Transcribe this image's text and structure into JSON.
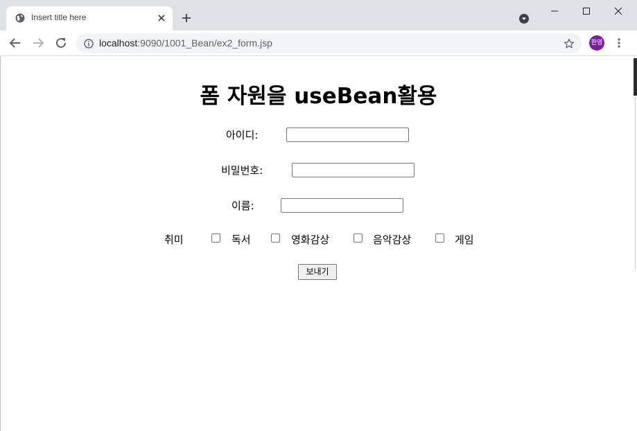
{
  "browser": {
    "tab_title": "Insert title here",
    "url_host": "localhost",
    "url_rest": ":9090/1001_Bean/ex2_form.jsp",
    "profile_label": "한영",
    "profile_color": "#7b1fa2"
  },
  "page": {
    "title": "폼 자원을 useBean활용",
    "fields": {
      "id_label": "아이디:",
      "id_value": "",
      "pw_label": "비밀번호:",
      "pw_value": "",
      "name_label": "이름:",
      "name_value": ""
    },
    "hobby": {
      "label": "취미",
      "options": [
        {
          "label": "독서",
          "checked": false
        },
        {
          "label": "영화감상",
          "checked": false
        },
        {
          "label": "음악감상",
          "checked": false
        },
        {
          "label": "게임",
          "checked": false
        }
      ]
    },
    "submit_label": "보내기"
  }
}
